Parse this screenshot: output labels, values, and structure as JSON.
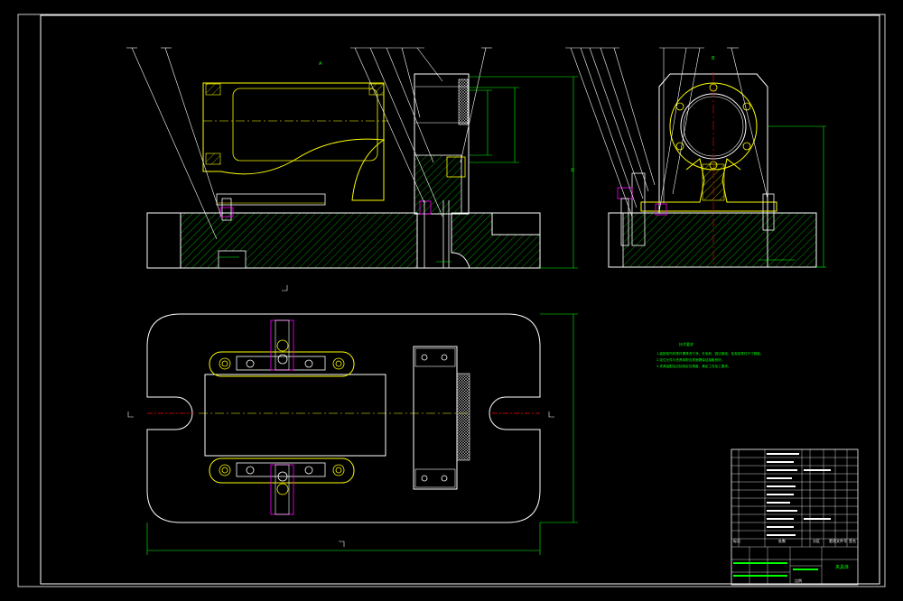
{
  "drawing": {
    "colors": {
      "background": "#000000",
      "outline": "#ffffff",
      "part": "#ffff00",
      "hatch": "#00ff00",
      "dimension": "#00ff00",
      "centerline": "#ff0000",
      "fastener": "#ff00ff"
    }
  },
  "tech_notes": {
    "title": "技术要求",
    "lines": [
      "1.装配前所有零件需清洗干净，去毛刺、锐边倒钝，检查各零件尺寸精度。",
      "2.定位元件与夹具体配合表面需保证接触良好。",
      "3.夹具装配后应检验定位精度，满足工件加工要求。"
    ]
  },
  "title_block": {
    "bottom_labels": [
      "标记",
      "处数",
      "分区",
      "更改文件号",
      "签名"
    ],
    "name_cell": "夹具体",
    "scale_cell": "比例"
  }
}
